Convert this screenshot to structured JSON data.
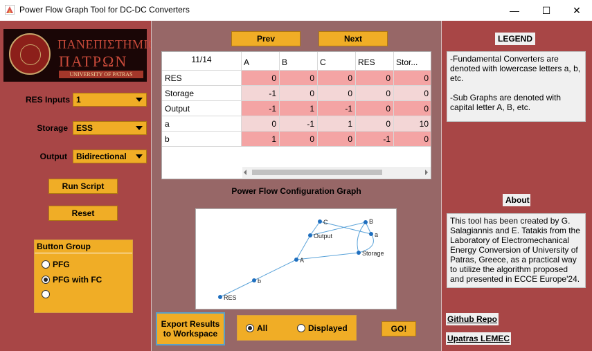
{
  "window": {
    "title": "Power Flow Graph Tool for DC-DC Converters",
    "minimize_glyph": "—",
    "maximize_glyph": "☐",
    "close_glyph": "✕"
  },
  "logo": {
    "line1": "ΠΑΝΕΠΙΣΤΗΜΙΟ",
    "line2": "ΠΑΤΡΩΝ",
    "line3": "UNIVERSITY OF PATRAS"
  },
  "left": {
    "res_inputs_label": "RES Inputs",
    "res_inputs_value": "1",
    "storage_label": "Storage",
    "storage_value": "ESS",
    "output_label": "Output",
    "output_value": "Bidirectional",
    "run_label": "Run Script",
    "reset_label": "Reset",
    "button_group": {
      "title": "Button Group",
      "options": [
        "PFG",
        "PFG with FC",
        ""
      ],
      "selected": 1
    }
  },
  "center": {
    "prev_label": "Prev",
    "next_label": "Next",
    "table": {
      "counter": "11/14",
      "columns": [
        "A",
        "B",
        "C",
        "RES",
        "Stor..."
      ],
      "rows": [
        {
          "label": "RES",
          "values": [
            "0",
            "0",
            "0",
            "0",
            "0"
          ]
        },
        {
          "label": "Storage",
          "values": [
            "-1",
            "0",
            "0",
            "0",
            "0"
          ]
        },
        {
          "label": "Output",
          "values": [
            "-1",
            "1",
            "-1",
            "0",
            "0"
          ]
        },
        {
          "label": "a",
          "values": [
            "0",
            "-1",
            "1",
            "0",
            "10"
          ]
        },
        {
          "label": "b",
          "values": [
            "1",
            "0",
            "0",
            "-1",
            "0"
          ]
        }
      ]
    },
    "graph_title": "Power Flow Configuration Graph",
    "graph_nodes": {
      "res": "RES",
      "b": "b",
      "A": "A",
      "output": "Output",
      "C": "C",
      "B": "B",
      "a": "a",
      "storage": "Storage"
    },
    "export_label": "Export Results to Workspace",
    "scope_options": [
      "All",
      "Displayed"
    ],
    "scope_selected": 0,
    "go_label": "GO!"
  },
  "right": {
    "legend_title": "LEGEND",
    "legend_text1": "-Fundamental Converters are denoted with lowercase letters a, b, etc.",
    "legend_text2": "-Sub Graphs are denoted with capital letter A, B, etc.",
    "about_title": "About",
    "about_text": "This tool has been created by G. Salagiannis and E. Tatakis from the Laboratory of Electromechanical Energy Conversion of University of Patras, Greece, as a practical way to utilize the algorithm proposed and presented in ECCE Europe'24.",
    "github_label": "Github Repo",
    "lemec_label": "Upatras LEMEC"
  },
  "colors": {
    "panel_red": "#a84646",
    "panel_center": "#976767",
    "accent_orange": "#f0ad26",
    "row_highlight": "#f4a4a4",
    "row_alt": "#f3d6d6",
    "node_blue": "#1f6fbf"
  }
}
